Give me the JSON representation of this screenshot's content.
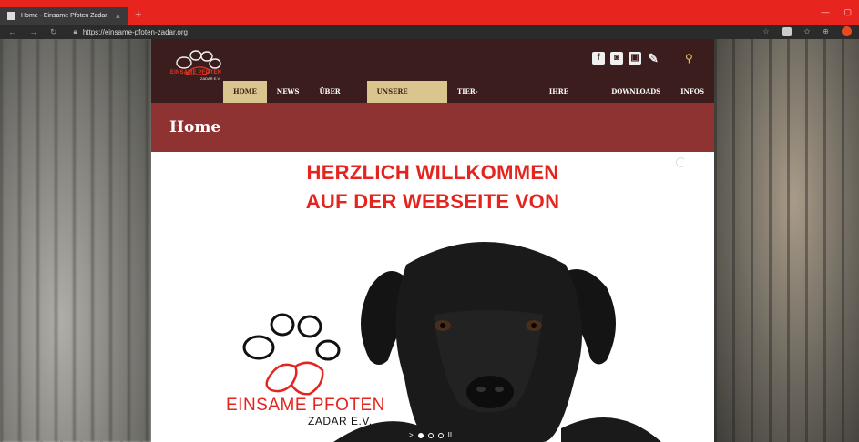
{
  "browser": {
    "tab_title": "Home - Einsame Pfoten Zadar",
    "tab_close": "×",
    "new_tab": "+",
    "back": "←",
    "forward": "→",
    "reload": "↻",
    "lock": "🔒",
    "url": "https://einsame-pfoten-zadar.org"
  },
  "site": {
    "logo": {
      "line1": "EINSAME PFOTEN",
      "line2": "ZADAR E.V."
    },
    "social": [
      "f",
      "◙",
      "▣",
      "✎"
    ],
    "search": "⚲",
    "menu": [
      {
        "label": "HOME",
        "active": true
      },
      {
        "label": "NEWS",
        "active": false
      },
      {
        "label": "ÜBER UNS",
        "active": false
      },
      {
        "label": "UNSERE PFOTEN",
        "active": true
      },
      {
        "label": "TIER-VERMITTLUNG",
        "active": false
      },
      {
        "label": "IHRE HILFE",
        "active": false
      },
      {
        "label": "DOWNLOADS",
        "active": false
      },
      {
        "label": "INFOS",
        "active": false
      }
    ],
    "page_title": "Home",
    "slider": {
      "headline1": "HERZLICH WILLKOMMEN",
      "headline2": "AUF DER WEBSEITE VON",
      "brand1": "EINSAME PFOTEN",
      "brand2": "ZADAR E.V.",
      "play": ">",
      "pause": "II"
    }
  },
  "colors": {
    "header": "#3c1d1d",
    "title_bar": "#8f3232",
    "accent": "#d9c58e",
    "brand_red": "#e4251f",
    "browser_bar": "#e8241f"
  }
}
